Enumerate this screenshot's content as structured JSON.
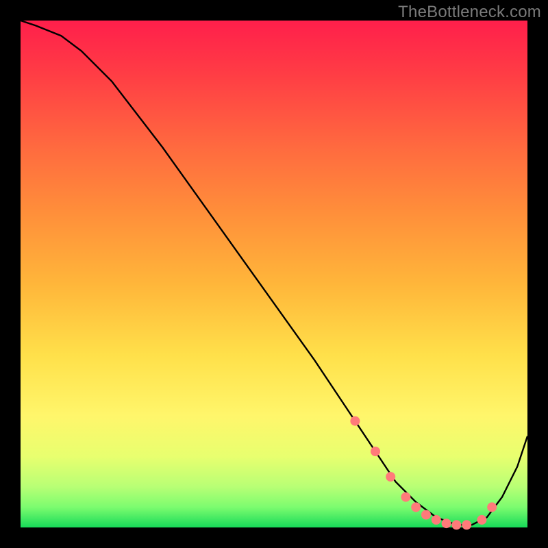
{
  "watermark": "TheBottleneck.com",
  "colors": {
    "background": "#000000",
    "curve": "#000000",
    "marker": "#ff7a7a",
    "gradient_stops": [
      "#ff1f4b",
      "#ff3b45",
      "#ff6a3f",
      "#ff8f3a",
      "#ffb63a",
      "#ffe04a",
      "#fff66b",
      "#e8ff6f",
      "#b8ff75",
      "#7cfc6f",
      "#17da59"
    ]
  },
  "chart_data": {
    "type": "line",
    "title": "",
    "xlabel": "",
    "ylabel": "",
    "xlim": [
      0,
      1
    ],
    "ylim": [
      0,
      1
    ],
    "series": [
      {
        "name": "curve",
        "x": [
          0.0,
          0.03,
          0.08,
          0.12,
          0.18,
          0.28,
          0.38,
          0.48,
          0.58,
          0.66,
          0.7,
          0.74,
          0.78,
          0.82,
          0.86,
          0.89,
          0.92,
          0.95,
          0.98,
          1.0
        ],
        "y": [
          1.0,
          0.99,
          0.97,
          0.94,
          0.88,
          0.75,
          0.61,
          0.47,
          0.33,
          0.21,
          0.15,
          0.09,
          0.05,
          0.02,
          0.005,
          0.005,
          0.02,
          0.06,
          0.12,
          0.18
        ]
      }
    ],
    "markers": {
      "name": "highlight-points",
      "x": [
        0.66,
        0.7,
        0.73,
        0.76,
        0.78,
        0.8,
        0.82,
        0.84,
        0.86,
        0.88,
        0.91,
        0.93
      ],
      "y": [
        0.21,
        0.15,
        0.1,
        0.06,
        0.04,
        0.025,
        0.015,
        0.008,
        0.005,
        0.005,
        0.015,
        0.04
      ]
    }
  }
}
